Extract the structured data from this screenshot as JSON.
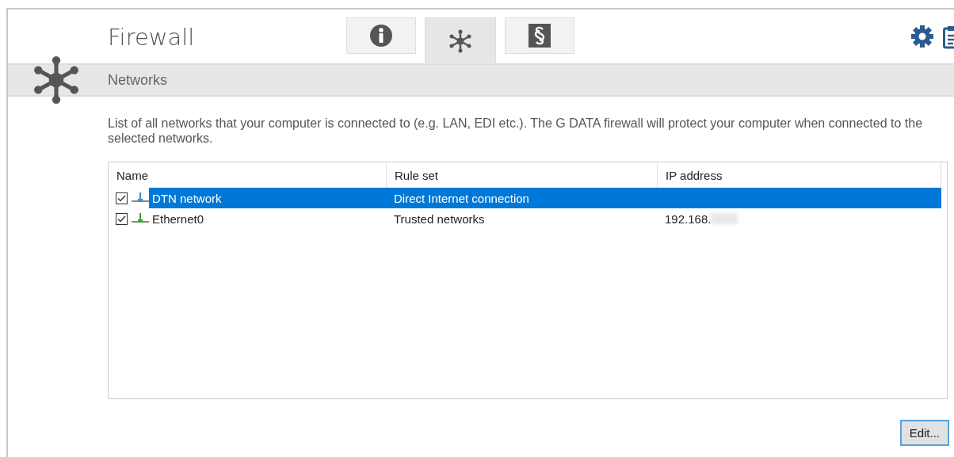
{
  "window": {
    "title": "Firewall"
  },
  "tabs": [
    {
      "kind": "info",
      "selected": false
    },
    {
      "kind": "network",
      "selected": true
    },
    {
      "kind": "legal",
      "selected": false
    }
  ],
  "toolbar": [
    {
      "kind": "settings"
    },
    {
      "kind": "clipboard"
    }
  ],
  "section": {
    "title": "Networks"
  },
  "description": "List of all networks that your computer is connected to (e.g. LAN, EDI etc.). The G DATA firewall will protect your computer when connected to the selected networks.",
  "table": {
    "columns": [
      "Name",
      "Rule set",
      "IP address"
    ],
    "rows": [
      {
        "name": "DTN network",
        "rule_set": "Direct Internet connection",
        "ip": "",
        "checked": true,
        "selected": true,
        "kind": "blue"
      },
      {
        "name": "Ethernet0",
        "rule_set": "Trusted networks",
        "ip": "192.168.",
        "checked": true,
        "selected": false,
        "kind": "green"
      }
    ]
  },
  "buttons": [
    {
      "label": "Edit..."
    }
  ]
}
